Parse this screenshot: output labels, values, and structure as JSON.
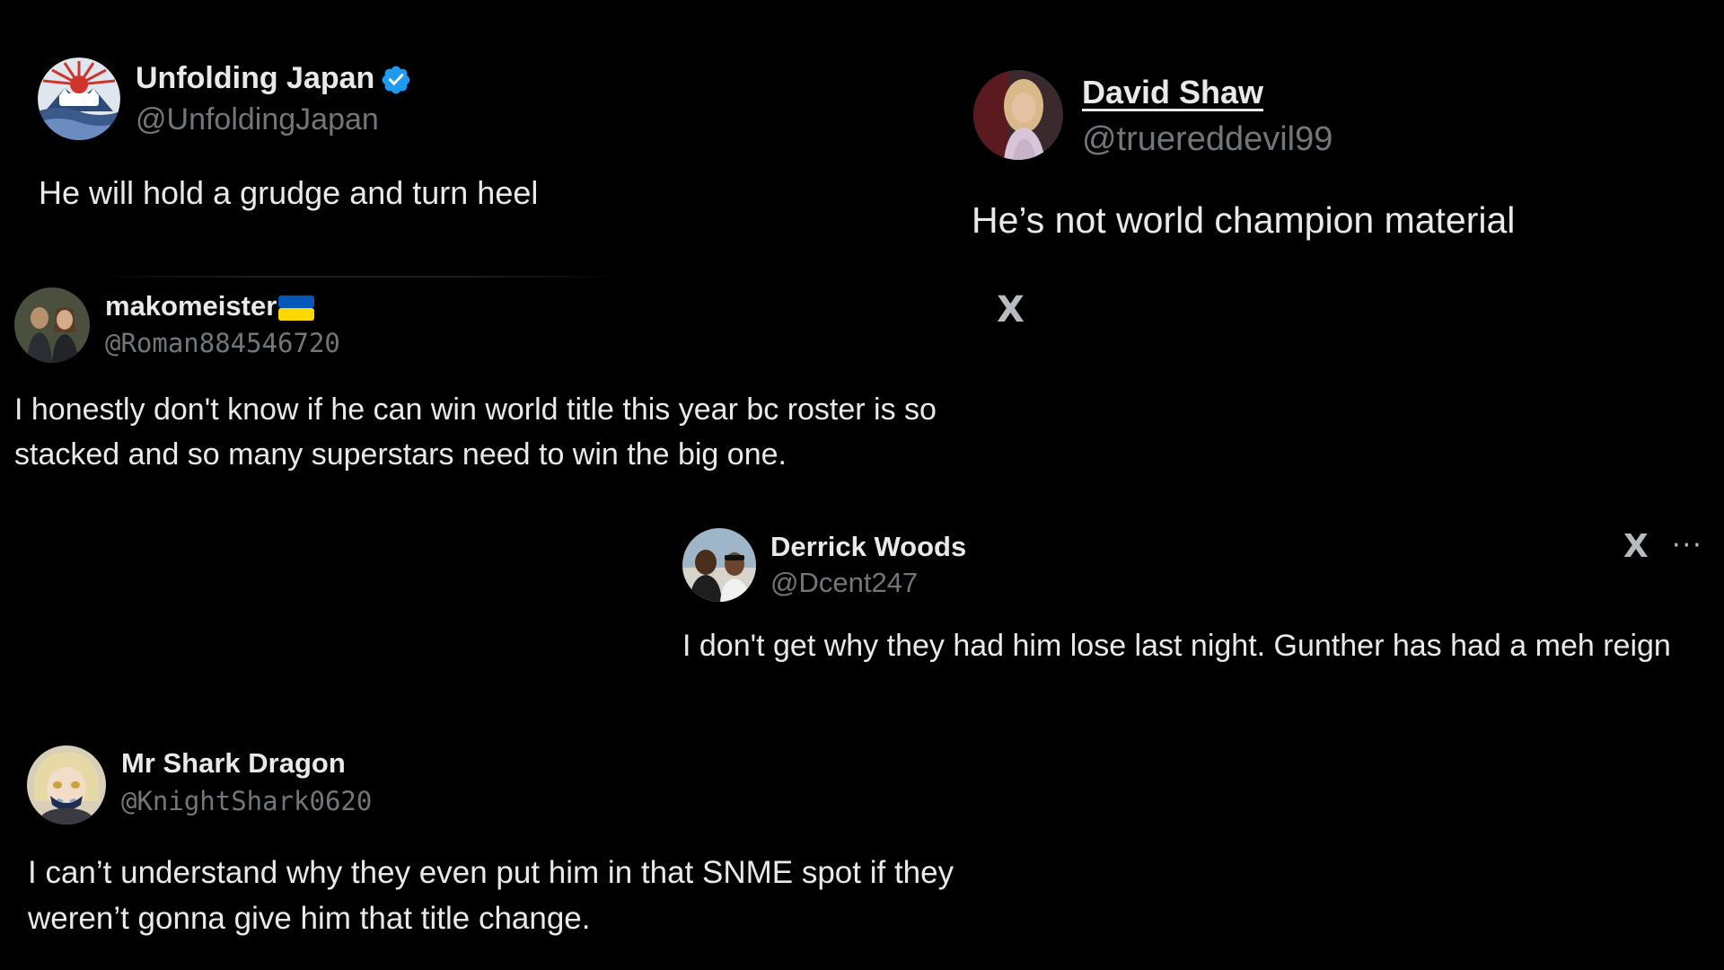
{
  "tweets": [
    {
      "name": "Unfolding Japan",
      "handle": "@UnfoldingJapan",
      "verified": true,
      "text": "He will hold a grudge and turn heel",
      "avatar": "unfolding-japan-logo"
    },
    {
      "name": "David Shaw",
      "handle": "@truereddevil99",
      "text": "He’s not world champion material",
      "avatar": "person-photo"
    },
    {
      "name": "makomeister",
      "flag": "ukraine-flag-icon",
      "handle": "@Roman884546720",
      "line1": "I honestly don't know if he can win world title this year bc roster is so",
      "line2": "stacked and so many superstars need to win the big one.",
      "avatar": "couple-photo"
    },
    {
      "name": "Derrick Woods",
      "handle": "@Dcent247",
      "text": "I don't get why they had him lose last night. Gunther has had a meh reign",
      "avatar": "group-photo"
    },
    {
      "name": "Mr Shark Dragon",
      "handle": "@KnightShark0620",
      "line1": "I can’t understand why they even put him in that SNME spot if they",
      "line2": "weren’t gonna give him that title change.",
      "avatar": "anime-character"
    }
  ],
  "icons": {
    "x_logo": "x-logo-icon",
    "more": "more-options-icon",
    "x_logo_glyph": "X",
    "more_glyph": "···"
  },
  "colors": {
    "background": "#000000",
    "text": "#e7e9ea",
    "handle": "#71767b",
    "verified": "#1d9bf0",
    "flag_blue": "#0057b7",
    "flag_yellow": "#ffd700"
  }
}
